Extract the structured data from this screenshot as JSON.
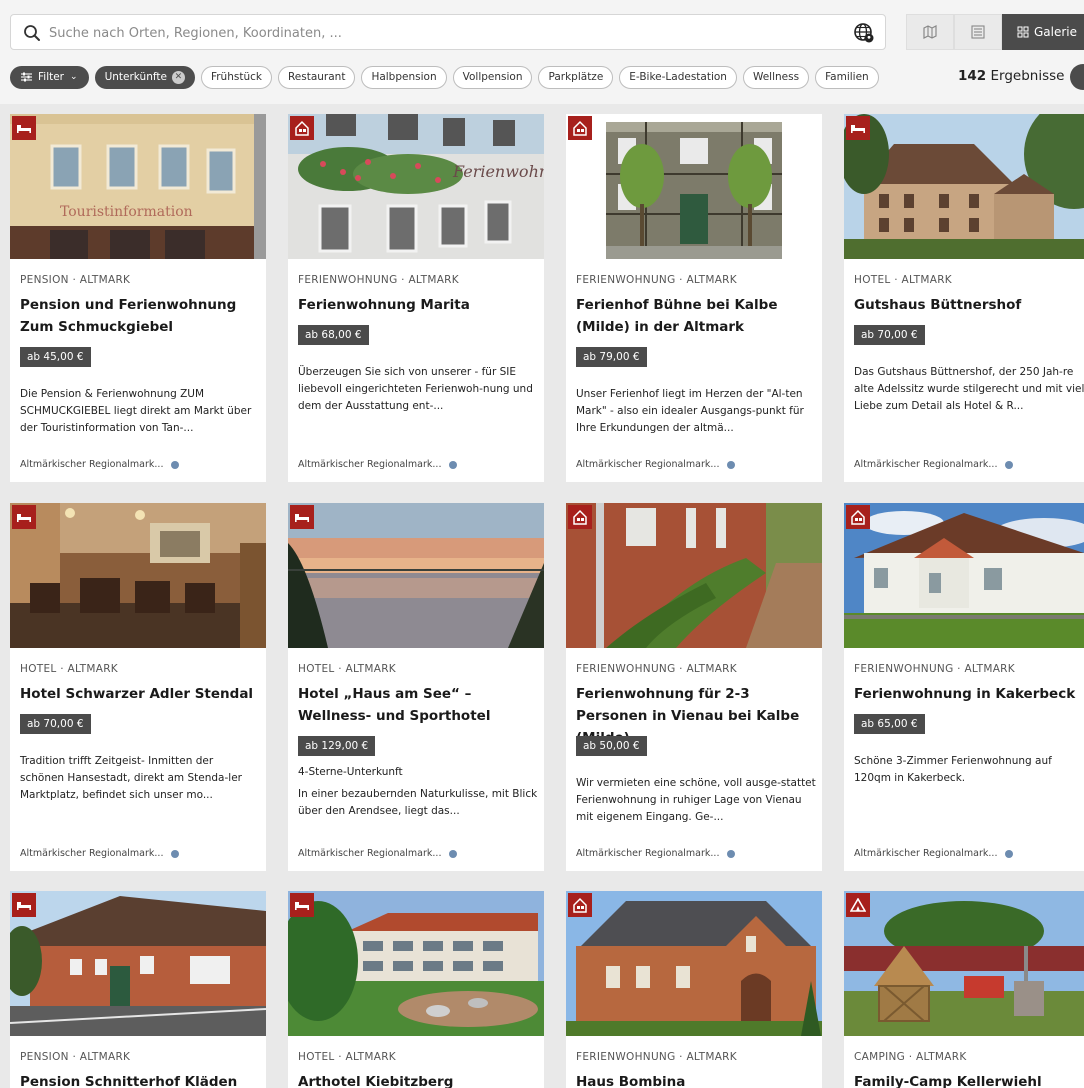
{
  "search": {
    "placeholder": "Suche nach Orten, Regionen, Koordinaten, ..."
  },
  "view_toggle": {
    "map_icon": "map-icon",
    "list_icon": "list-icon",
    "gallery_label": "Galerie"
  },
  "filters": {
    "filter_label": "Filter",
    "active_chip": "Unterkünfte",
    "chips": [
      "Frühstück",
      "Restaurant",
      "Halbpension",
      "Vollpension",
      "Parkplätze",
      "E-Bike-Ladestation",
      "Wellness",
      "Familien"
    ]
  },
  "results": {
    "count": "142",
    "label": "Ergebnisse"
  },
  "colors": {
    "accent": "#a7201c",
    "dark": "#4b4b4b",
    "footer_dot": "#6d8cb0"
  },
  "cards": [
    {
      "category": "PENSION · ALTMARK",
      "title": "Pension und Ferienwohnung Zum Schmuckgiebel",
      "price": "ab 45,00 €",
      "description": "Die Pension & Ferienwohnung ZUM SCHMUCKGIEBEL liegt direkt am Markt über der Touristinformation von Tan-...",
      "source": "Altmärkischer Regionalmark...",
      "badge_icon": "bed-icon",
      "image_label": "Touristinformation"
    },
    {
      "category": "FERIENWOHNUNG · ALTMARK",
      "title": "Ferienwohnung Marita",
      "price": "ab 68,00 €",
      "description": "Überzeugen Sie sich von unserer - für SIE liebevoll eingerichteten Ferienwoh-nung und dem der Ausstattung ent-...",
      "source": "Altmärkischer Regionalmark...",
      "badge_icon": "house-icon",
      "image_label": "Ferienwohnung"
    },
    {
      "category": "FERIENWOHNUNG · ALTMARK",
      "title": "Ferienhof Bühne bei Kalbe (Milde) in der Altmark",
      "price": "ab 79,00 €",
      "description": "Unser Ferienhof liegt im Herzen der \"Al-ten Mark\" - also ein idealer Ausgangs-punkt für Ihre Erkundungen der altmä...",
      "source": "Altmärkischer Regionalmark...",
      "badge_icon": "house-icon"
    },
    {
      "category": "HOTEL · ALTMARK",
      "title": "Gutshaus Büttnershof",
      "price": "ab 70,00 €",
      "description": "Das Gutshaus Büttnershof, der 250 Jah-re alte Adelssitz wurde stilgerecht und mit viel Liebe zum Detail als Hotel & R...",
      "source": "Altmärkischer Regionalmark...",
      "badge_icon": "bed-icon"
    },
    {
      "category": "HOTEL · ALTMARK",
      "title": "Hotel Schwarzer Adler Stendal",
      "price": "ab 70,00 €",
      "description": "Tradition trifft Zeitgeist- Inmitten der schönen Hansestadt, direkt am Stenda-ler Marktplatz, befindet sich unser mo...",
      "source": "Altmärkischer Regionalmark...",
      "badge_icon": "bed-icon"
    },
    {
      "category": "HOTEL · ALTMARK",
      "title": "Hotel „Haus am See“ – Wellness- und Sporthotel",
      "price": "ab 129,00 €",
      "extra": "4-Sterne-Unterkunft",
      "description": "In einer bezaubernden Naturkulisse, mit Blick über den Arendsee, liegt das...",
      "source": "Altmärkischer Regionalmark...",
      "badge_icon": "bed-icon"
    },
    {
      "category": "FERIENWOHNUNG · ALTMARK",
      "title": "Ferienwohnung für 2-3 Personen in Vienau bei Kalbe (Milde)",
      "price": "ab 50,00 €",
      "description": "Wir vermieten eine schöne, voll ausge-stattet Ferienwohnung in ruhiger Lage von Vienau mit eigenem Eingang. Ge-...",
      "source": "Altmärkischer Regionalmark...",
      "badge_icon": "house-icon"
    },
    {
      "category": "FERIENWOHNUNG · ALTMARK",
      "title": "Ferienwohnung in Kakerbeck",
      "price": "ab 65,00 €",
      "description": "Schöne 3-Zimmer Ferienwohnung auf 120qm in Kakerbeck.",
      "source": "Altmärkischer Regionalmark...",
      "badge_icon": "house-icon"
    },
    {
      "category": "PENSION · ALTMARK",
      "title": "Pension Schnitterhof Kläden",
      "badge_icon": "bed-icon"
    },
    {
      "category": "HOTEL · ALTMARK",
      "title": "Arthotel Kiebitzberg",
      "badge_icon": "bed-icon"
    },
    {
      "category": "FERIENWOHNUNG · ALTMARK",
      "title": "Haus Bombina",
      "badge_icon": "house-icon"
    },
    {
      "category": "CAMPING · ALTMARK",
      "title": "Family-Camp Kellerwiehl",
      "badge_icon": "tent-icon"
    }
  ]
}
